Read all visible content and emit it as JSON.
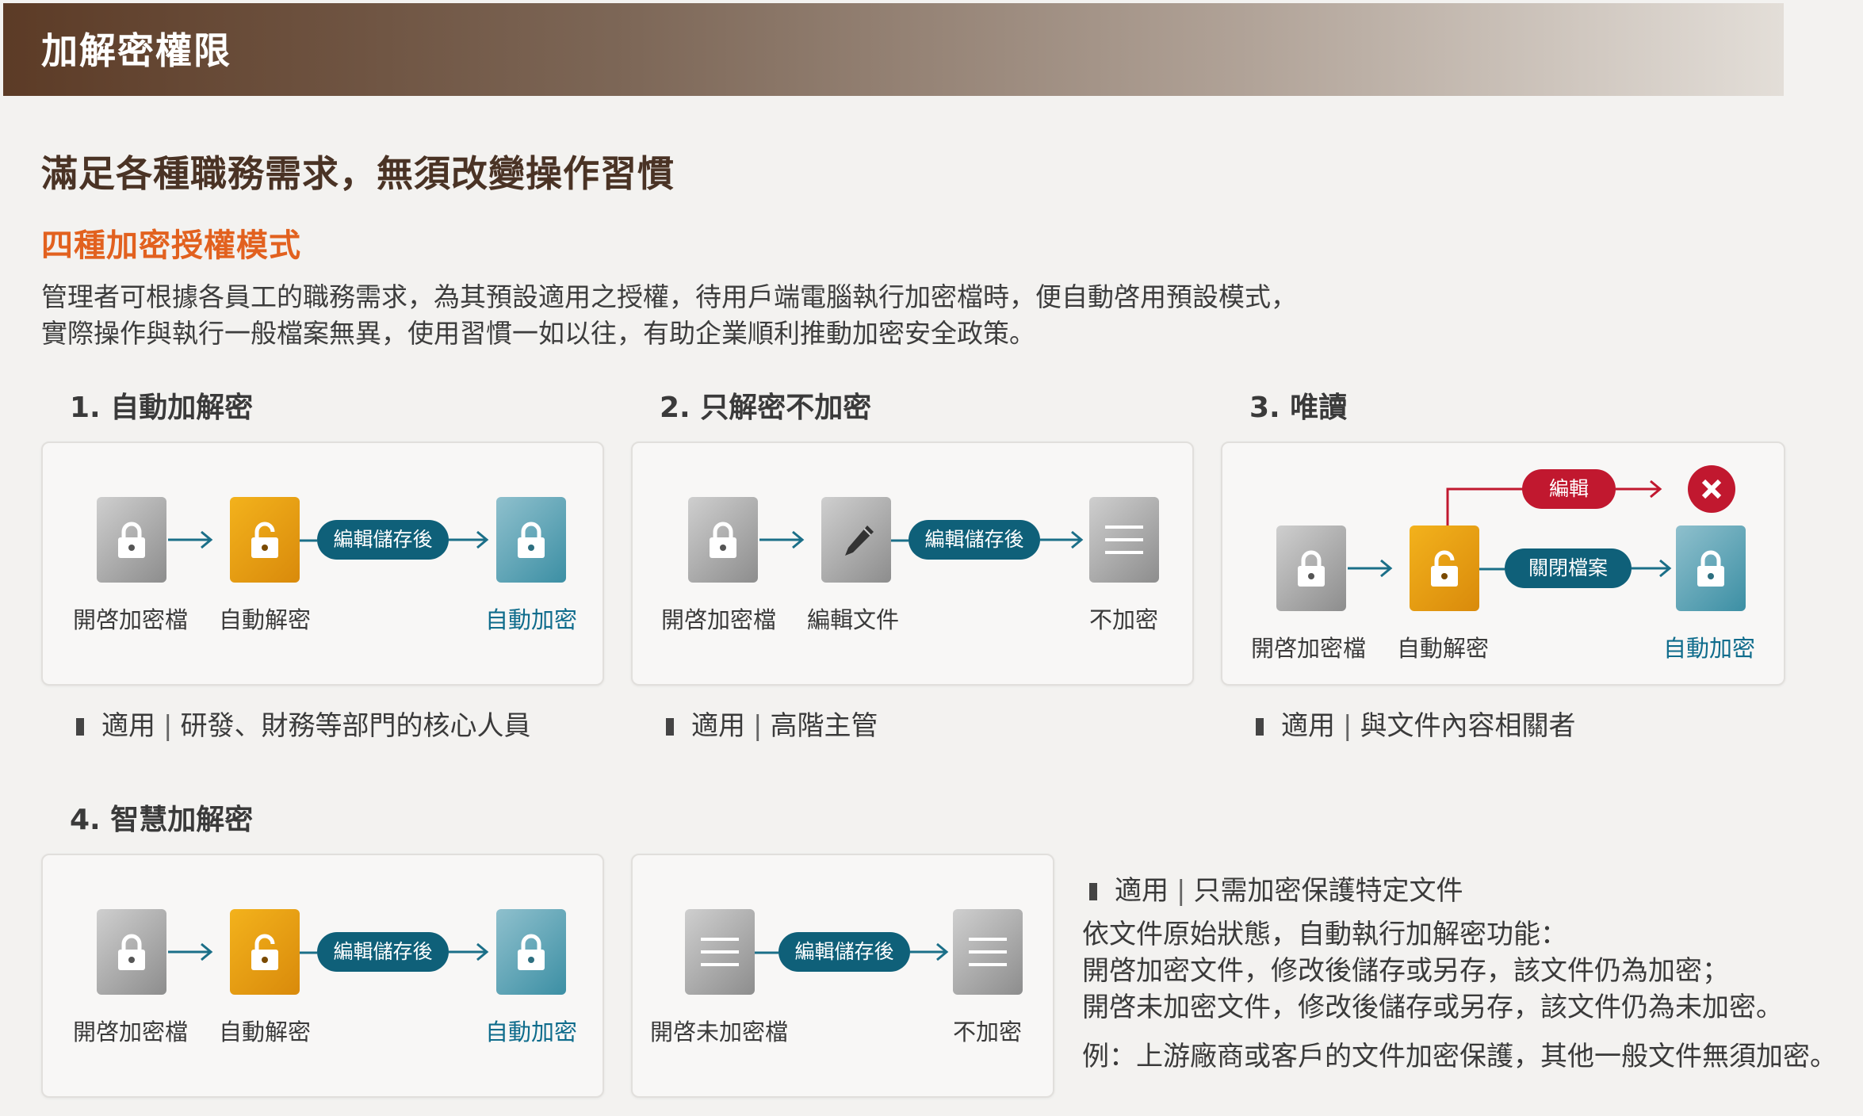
{
  "header": {
    "title": "加解密權限"
  },
  "headline": "滿足各種職務需求，無須改變操作習慣",
  "subhead": "四種加密授權模式",
  "intro": {
    "line1": "管理者可根據各員工的職務需求，為其預設適用之授權，待用戶端電腦執行加密檔時，便自動啓用預設模式，",
    "line2": "實際操作與執行一般檔案無異，使用習慣一如以往，有助企業順利推動加密安全政策。"
  },
  "modes": [
    {
      "title": "1. 自動加解密",
      "pill": "編輯儲存後",
      "labels": [
        "開啓加密檔",
        "自動解密",
        "自動加密"
      ],
      "note": {
        "key": "適用",
        "value": "研發、財務等部門的核心人員"
      }
    },
    {
      "title": "2. 只解密不加密",
      "pill": "編輯儲存後",
      "labels": [
        "開啓加密檔",
        "編輯文件",
        "不加密"
      ],
      "note": {
        "key": "適用",
        "value": "高階主管"
      }
    },
    {
      "title": "3. 唯讀",
      "pill_edit": "編輯",
      "pill_close": "關閉檔案",
      "labels": [
        "開啓加密檔",
        "自動解密",
        "自動加密"
      ],
      "note": {
        "key": "適用",
        "value": "與文件內容相關者"
      }
    },
    {
      "title": "4. 智慧加解密",
      "pill": "編輯儲存後",
      "labels": [
        "開啓加密檔",
        "自動解密",
        "自動加密"
      ],
      "pill_b": "編輯儲存後",
      "labels_b": [
        "開啓未加密檔",
        "不加密"
      ],
      "note": {
        "key": "適用",
        "value": "只需加密保護特定文件"
      },
      "desc": [
        "依文件原始狀態，自動執行加解密功能：",
        "開啓加密文件，修改後儲存或另存，該文件仍為加密；",
        "開啓未加密文件，修改後儲存或另存，該文件仍為未加密。",
        "例：上游廠商或客戶的文件加密保護，其他一般文件無須加密。"
      ]
    }
  ],
  "colors": {
    "accent_orange": "#e2611f",
    "pill_teal": "#0f6079",
    "pill_red": "#c1182f",
    "label_teal": "#0f6c8c",
    "header_brown": "#5c3b26"
  },
  "icons": [
    "lock-closed-icon",
    "lock-open-icon",
    "pencil-icon",
    "document-lines-icon",
    "arrow-right-icon",
    "close-x-icon"
  ]
}
